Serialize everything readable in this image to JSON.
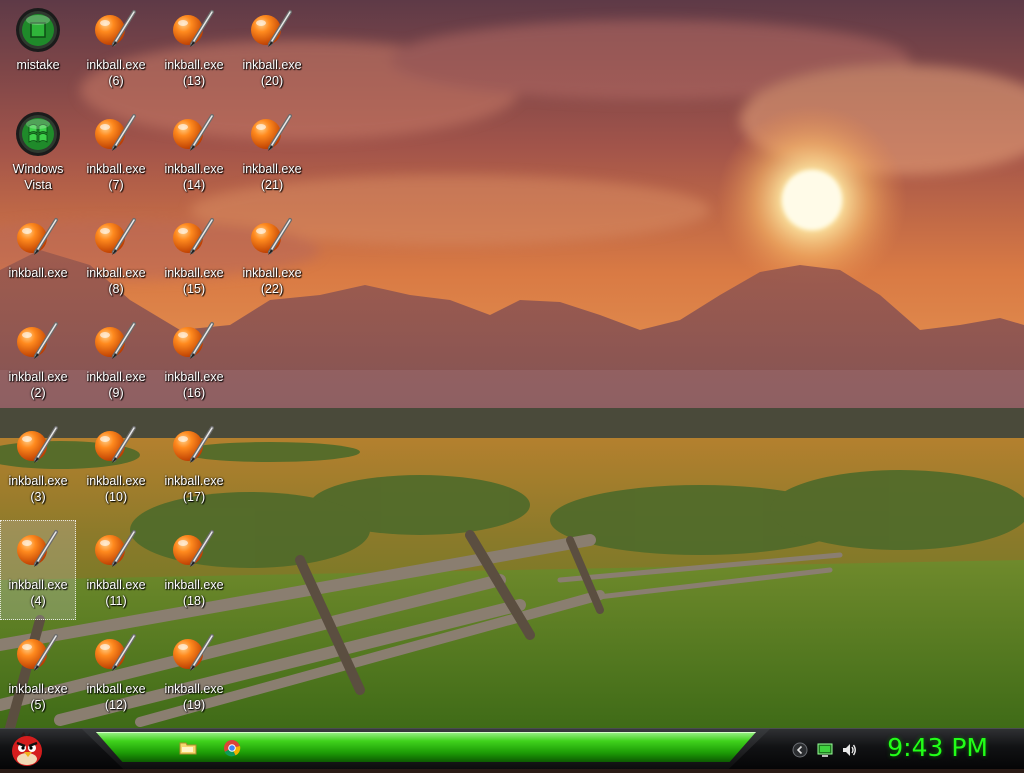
{
  "desktop": {
    "icons": [
      {
        "line1": "mistake",
        "line2": "",
        "kind": "orb-green-square",
        "selected": false
      },
      {
        "line1": "Windows",
        "line2": "Vista",
        "kind": "orb-green-flag",
        "selected": false
      },
      {
        "line1": "inkball.exe",
        "line2": "",
        "kind": "inkball",
        "selected": false
      },
      {
        "line1": "inkball.exe",
        "line2": "(2)",
        "kind": "inkball",
        "selected": false
      },
      {
        "line1": "inkball.exe",
        "line2": "(3)",
        "kind": "inkball",
        "selected": false
      },
      {
        "line1": "inkball.exe",
        "line2": "(4)",
        "kind": "inkball",
        "selected": true
      },
      {
        "line1": "inkball.exe",
        "line2": "(5)",
        "kind": "inkball",
        "selected": false
      },
      {
        "line1": "inkball.exe",
        "line2": "(6)",
        "kind": "inkball",
        "selected": false
      },
      {
        "line1": "inkball.exe",
        "line2": "(7)",
        "kind": "inkball",
        "selected": false
      },
      {
        "line1": "inkball.exe",
        "line2": "(8)",
        "kind": "inkball",
        "selected": false
      },
      {
        "line1": "inkball.exe",
        "line2": "(9)",
        "kind": "inkball",
        "selected": false
      },
      {
        "line1": "inkball.exe",
        "line2": "(10)",
        "kind": "inkball",
        "selected": false
      },
      {
        "line1": "inkball.exe",
        "line2": "(11)",
        "kind": "inkball",
        "selected": false
      },
      {
        "line1": "inkball.exe",
        "line2": "(12)",
        "kind": "inkball",
        "selected": false
      },
      {
        "line1": "inkball.exe",
        "line2": "(13)",
        "kind": "inkball",
        "selected": false
      },
      {
        "line1": "inkball.exe",
        "line2": "(14)",
        "kind": "inkball",
        "selected": false
      },
      {
        "line1": "inkball.exe",
        "line2": "(15)",
        "kind": "inkball",
        "selected": false
      },
      {
        "line1": "inkball.exe",
        "line2": "(16)",
        "kind": "inkball",
        "selected": false
      },
      {
        "line1": "inkball.exe",
        "line2": "(17)",
        "kind": "inkball",
        "selected": false
      },
      {
        "line1": "inkball.exe",
        "line2": "(18)",
        "kind": "inkball",
        "selected": false
      },
      {
        "line1": "inkball.exe",
        "line2": "(19)",
        "kind": "inkball",
        "selected": false
      },
      {
        "line1": "inkball.exe",
        "line2": "(20)",
        "kind": "inkball",
        "selected": false
      },
      {
        "line1": "inkball.exe",
        "line2": "(21)",
        "kind": "inkball",
        "selected": false
      },
      {
        "line1": "inkball.exe",
        "line2": "(22)",
        "kind": "inkball",
        "selected": false
      }
    ]
  },
  "taskbar": {
    "start_icon": "angry-bird-icon",
    "apps": [
      "folder-icon",
      "chrome-icon"
    ],
    "tray": [
      "chevron-left-icon",
      "network-icon",
      "volume-icon"
    ],
    "clock": "9:43 PM",
    "clock_color": "#22ff18",
    "band_color": "#3fd21c"
  }
}
